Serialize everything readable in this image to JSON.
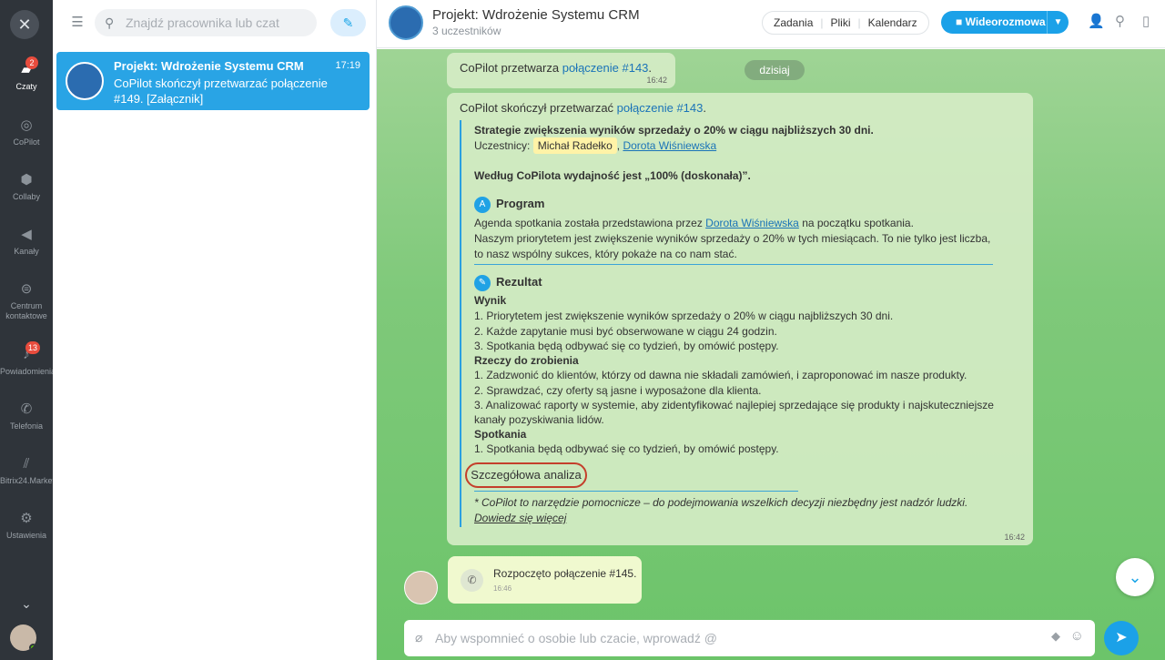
{
  "nav": {
    "close": "✕",
    "items": [
      {
        "label": "Czaty",
        "icon": "chat-icon",
        "badge": "2",
        "active": true
      },
      {
        "label": "CoPilot",
        "icon": "copilot-icon"
      },
      {
        "label": "Collaby",
        "icon": "collab-icon"
      },
      {
        "label": "Kanały",
        "icon": "megaphone-icon"
      },
      {
        "label": "Centrum kontaktowe",
        "icon": "contact-center-icon"
      },
      {
        "label": "Powiadomienia",
        "icon": "bell-icon",
        "badge": "13"
      },
      {
        "label": "Telefonia",
        "icon": "phone-icon"
      },
      {
        "label": "Bitrix24.Market",
        "icon": "market-icon"
      },
      {
        "label": "Ustawienia",
        "icon": "gear-icon"
      }
    ]
  },
  "sidebar": {
    "search_placeholder": "Znajdź pracownika lub czat",
    "chat": {
      "title": "Projekt: Wdrożenie Systemu CRM",
      "time": "17:19",
      "preview": "CoPilot skończył przetwarzać połączenie #149. [Załącznik]"
    }
  },
  "header": {
    "title": "Projekt: Wdrożenie Systemu CRM",
    "subtitle": "3 uczestników",
    "tabs": [
      "Zadania",
      "Pliki",
      "Kalendarz"
    ],
    "video_label": "Wideorozmowa"
  },
  "chat": {
    "date_pill": "dzisiaj",
    "msg1": {
      "prefix": "CoPilot przetwarza ",
      "link": "połączenie #143",
      "suffix": ".",
      "time": "16:42"
    },
    "msg2": {
      "prefix": "CoPilot skończył przetwarzać ",
      "link": "połączenie #143",
      "suffix": ".",
      "heading": "Strategie zwiększenia wyników sprzedaży o 20% w ciągu najbliższych 30 dni.",
      "participants_label": "Uczestnicy:",
      "participant1": "Michał Radełko",
      "participant_sep": ",",
      "participant2": "Dorota Wiśniewska",
      "rating": "Według CoPilota wydajność jest „100% (doskonała)”.",
      "program_title": "Program",
      "program_line1_a": "Agenda spotkania została przedstawiona przez ",
      "program_line1_link": "Dorota Wiśniewska",
      "program_line1_b": " na początku spotkania.",
      "program_line2": "Naszym priorytetem jest zwiększenie wyników sprzedaży o 20% w tych miesiącach. To nie tylko jest liczba,",
      "program_line3": "to nasz wspólny sukces, który pokaże na co nam stać.",
      "result_title": "Rezultat",
      "wynik_title": "Wynik",
      "wynik": [
        "1. Priorytetem jest zwiększenie wyników sprzedaży o 20% w ciągu najbliższych 30 dni.",
        "2. Każde zapytanie musi być obserwowane w ciągu 24 godzin.",
        "3. Spotkania będą odbywać się co tydzień, by omówić postępy."
      ],
      "todo_title": "Rzeczy do zrobienia",
      "todo": [
        "1. Zadzwonić do klientów, którzy od dawna nie składali zamówień, i zaproponować im nasze produkty.",
        "2. Sprawdzać, czy oferty są jasne i wyposażone dla klienta.",
        "3. Analizować raporty w systemie, aby zidentyfikować najlepiej sprzedające się produkty i najskuteczniejsze",
        "kanały pozyskiwania lidów."
      ],
      "meet_title": "Spotkania",
      "meet": [
        "1. Spotkania będą odbywać się co tydzień, by omówić postępy."
      ],
      "analysis_button": "Szczegółowa analiza",
      "disclaimer": "* CoPilot to narzędzie pomocnicze – do podejmowania wszelkich decyzji niezbędny jest nadzór ludzki.",
      "learn_more": "Dowiedz się więcej",
      "time": "16:42"
    },
    "call": {
      "text": "Rozpoczęto połączenie #145.",
      "time": "16:46"
    },
    "input_placeholder": "Aby wspomnieć o osobie lub czacie, wprowadź @"
  }
}
